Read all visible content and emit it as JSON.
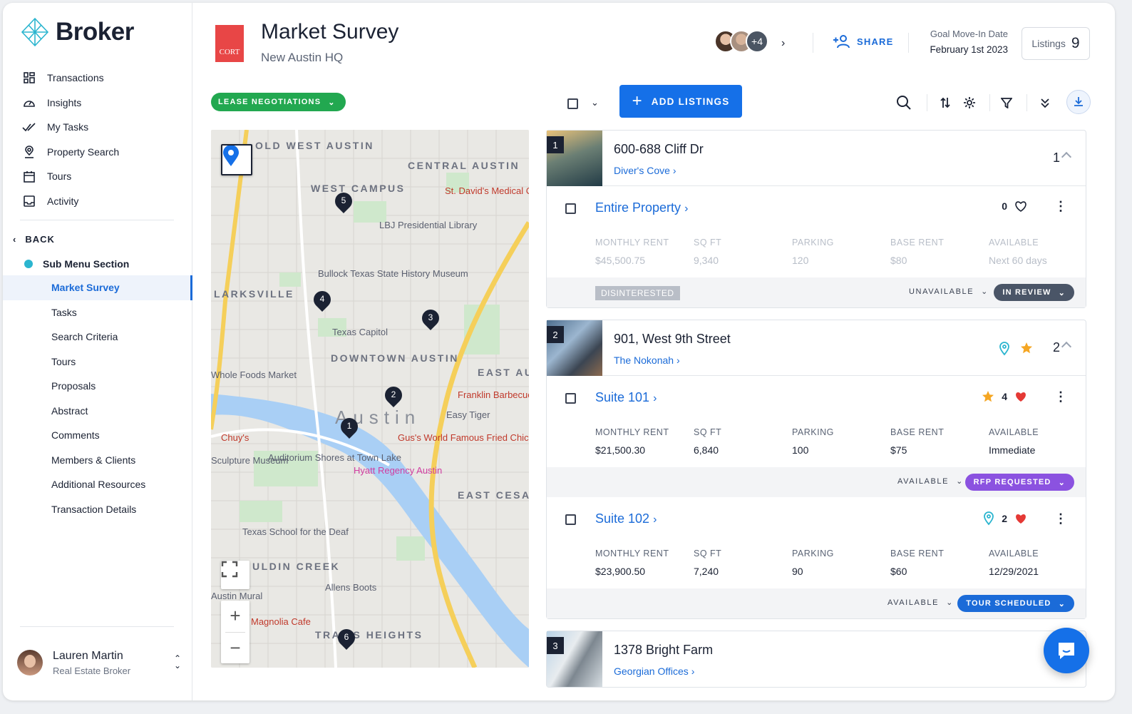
{
  "brand": {
    "name": "Broker"
  },
  "nav": [
    {
      "label": "Transactions",
      "icon": "grid-icon"
    },
    {
      "label": "Insights",
      "icon": "gauge-icon"
    },
    {
      "label": "My Tasks",
      "icon": "double-check-icon"
    },
    {
      "label": "Property Search",
      "icon": "location-pin-icon"
    },
    {
      "label": "Tours",
      "icon": "calendar-icon"
    },
    {
      "label": "Activity",
      "icon": "inbox-icon"
    }
  ],
  "back_label": "BACK",
  "sub_menu_title": "Sub Menu Section",
  "sub_menu": [
    "Market Survey",
    "Tasks",
    "Search Criteria",
    "Tours",
    "Proposals",
    "Abstract",
    "Comments",
    "Members & Clients",
    "Additional Resources",
    "Transaction Details"
  ],
  "user": {
    "name": "Lauren Martin",
    "role": "Real Estate Broker"
  },
  "header": {
    "client_logo_text": "CORT",
    "title": "Market Survey",
    "subtitle": "New Austin HQ",
    "avatars_more": "+4",
    "share_label": "SHARE",
    "goal_label": "Goal Move-In Date",
    "goal_value": "February 1st 2023",
    "listings_label": "Listings",
    "listings_count": "9"
  },
  "toolbar": {
    "stage_label": "LEASE NEGOTIATIONS",
    "add_label": "ADD LISTINGS"
  },
  "map": {
    "labels": [
      "OLD WEST AUSTIN",
      "CENTRAL AUSTIN",
      "WEST CAMPUS",
      "LARKSVILLE",
      "DOWNTOWN AUSTIN",
      "EAST AUSTIN",
      "Austin",
      "EAST CESAR CHAVEZ",
      "ULDIN CREEK",
      "TRAVIS HEIGHTS"
    ],
    "poi": [
      "St. David's Medical Center",
      "LBJ Presidential Library",
      "Bullock Texas State History Museum",
      "Texas Capitol",
      "Whole Foods Market",
      "Franklin Barbecue",
      "Easy Tiger",
      "Gus's World Famous Fried Chicken",
      "Chuy's",
      "Auditorium Shores at Town Lake",
      "Hyatt Regency Austin",
      "Texas School for the Deaf",
      "Allens Boots",
      "Magnolia Cafe",
      "Sculpture Museum",
      "Austin Mural"
    ],
    "pins": [
      "1",
      "2",
      "3",
      "4",
      "5",
      "6"
    ]
  },
  "properties": [
    {
      "number": "1",
      "name": "600-688 Cliff Dr",
      "link": "Diver's Cove",
      "count": "1",
      "suites": [
        {
          "name": "Entire Property",
          "likes": "0",
          "headers": [
            "MONTHLY RENT",
            "SQ FT",
            "PARKING",
            "BASE RENT",
            "AVAILABLE"
          ],
          "values": [
            "$45,500.75",
            "9,340",
            "120",
            "$80",
            "Next 60 days"
          ],
          "tag": "DISINTERESTED",
          "availability": "UNAVAILABLE",
          "status": "IN REVIEW",
          "status_color": "#4a5567"
        }
      ]
    },
    {
      "number": "2",
      "name": "901, West 9th Street",
      "link": "The Nokonah",
      "count": "2",
      "suites": [
        {
          "name": "Suite 101",
          "likes": "4",
          "headers": [
            "MONTHLY RENT",
            "SQ FT",
            "PARKING",
            "BASE RENT",
            "AVAILABLE"
          ],
          "values": [
            "$21,500.30",
            "6,840",
            "100",
            "$75",
            "Immediate"
          ],
          "availability": "AVAILABLE",
          "status": "RFP REQUESTED",
          "status_color": "#8b52e0"
        },
        {
          "name": "Suite 102",
          "likes": "2",
          "headers": [
            "MONTHLY RENT",
            "SQ FT",
            "PARKING",
            "BASE RENT",
            "AVAILABLE"
          ],
          "values": [
            "$23,900.50",
            "7,240",
            "90",
            "$60",
            "12/29/2021"
          ],
          "availability": "AVAILABLE",
          "status": "TOUR SCHEDULED",
          "status_color": "#1b6bd8"
        }
      ]
    },
    {
      "number": "3",
      "name": "1378 Bright Farm",
      "link": "Georgian Offices"
    }
  ],
  "colors": {
    "primary": "#1570e8",
    "stage": "#22a850",
    "heart": "#e53935",
    "star": "#f5a623",
    "teal": "#2bb5cf"
  }
}
